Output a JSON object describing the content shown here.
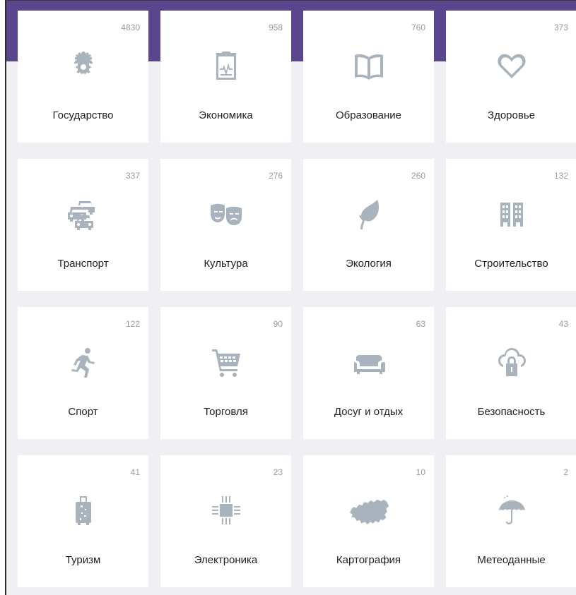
{
  "categories": [
    {
      "label": "Государство",
      "count": "4830",
      "icon": "coat-of-arms-icon"
    },
    {
      "label": "Экономика",
      "count": "958",
      "icon": "chart-report-icon"
    },
    {
      "label": "Образование",
      "count": "760",
      "icon": "open-book-icon"
    },
    {
      "label": "Здоровье",
      "count": "373",
      "icon": "heart-icon"
    },
    {
      "label": "Транспорт",
      "count": "337",
      "icon": "cars-icon"
    },
    {
      "label": "Культура",
      "count": "276",
      "icon": "theater-masks-icon"
    },
    {
      "label": "Экология",
      "count": "260",
      "icon": "leaf-icon"
    },
    {
      "label": "Строительство",
      "count": "132",
      "icon": "building-icon"
    },
    {
      "label": "Спорт",
      "count": "122",
      "icon": "runner-icon"
    },
    {
      "label": "Торговля",
      "count": "90",
      "icon": "shopping-cart-icon"
    },
    {
      "label": "Досуг и отдых",
      "count": "63",
      "icon": "sofa-icon"
    },
    {
      "label": "Безопасность",
      "count": "43",
      "icon": "cloud-lock-icon"
    },
    {
      "label": "Туризм",
      "count": "41",
      "icon": "suitcase-icon"
    },
    {
      "label": "Электроника",
      "count": "23",
      "icon": "chip-icon"
    },
    {
      "label": "Картография",
      "count": "10",
      "icon": "russia-map-icon"
    },
    {
      "label": "Метеоданные",
      "count": "2",
      "icon": "umbrella-icon"
    }
  ],
  "colors": {
    "accent": "#5a468f",
    "icon": "#a8b3be",
    "background": "#f0eff4"
  }
}
